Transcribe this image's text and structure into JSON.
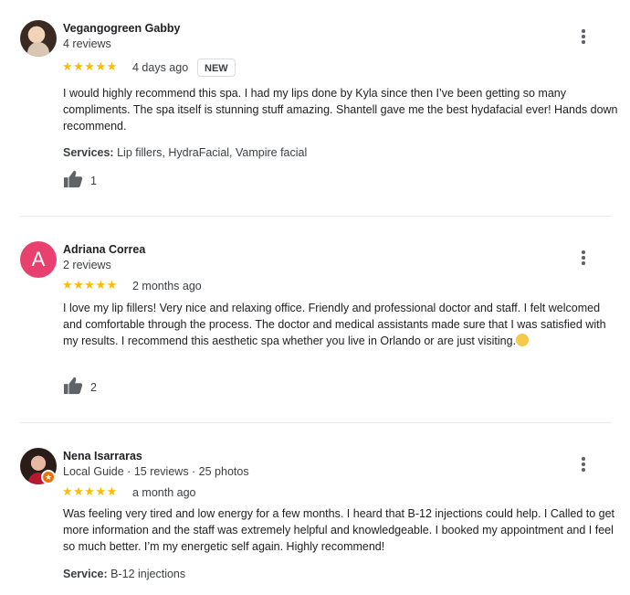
{
  "reviews": [
    {
      "name": "Vegangogreen Gabby",
      "meta": "4 reviews",
      "stars": "★★★★★",
      "date": "4 days ago",
      "badge": "NEW",
      "text": "I would highly recommend this spa. I had my lips done by Kyla since then I’ve been getting so many compliments. The spa itself is stunning stuff amazing. Shantell gave me the best hydafacial ever! Hands down recommend.",
      "services_label": "Services:",
      "services_value": "Lip fillers, HydraFacial, Vampire facial",
      "likes": "1"
    },
    {
      "name": "Adriana Correa",
      "avatar_letter": "A",
      "meta": "2 reviews",
      "stars": "★★★★★",
      "date": "2 months ago",
      "text": "I love my lip fillers! Very nice and relaxing office. Friendly and professional doctor and staff. I felt welcomed and comfortable through the process. The doctor and medical assistants made sure that I was satisfied with my results. I recommend this aesthetic spa whether you live in Orlando or are just visiting.",
      "likes": "2"
    },
    {
      "name": "Nena Isarraras",
      "meta": "Local Guide · 15 reviews · 25 photos",
      "stars": "★★★★★",
      "date": "a month ago",
      "text": "Was feeling very tired and low energy for a few months. I heard that B-12 injections could help. I Called to get more information and the staff was extremely helpful and knowledgeable. I booked my appointment and I feel so much better. I’m my energetic self again. Highly recommend!",
      "services_label": "Service:",
      "services_value": "B-12 injections"
    }
  ],
  "icons": {
    "more": "more-vert-icon",
    "like": "thumb-up-icon",
    "emoji": "smiling-face-icon",
    "guide": "local-guide-badge-icon"
  },
  "colors": {
    "stars": "#fbbc04",
    "avatar_letter_bg": "#e8406f",
    "guide_badge": "#e8710a"
  }
}
